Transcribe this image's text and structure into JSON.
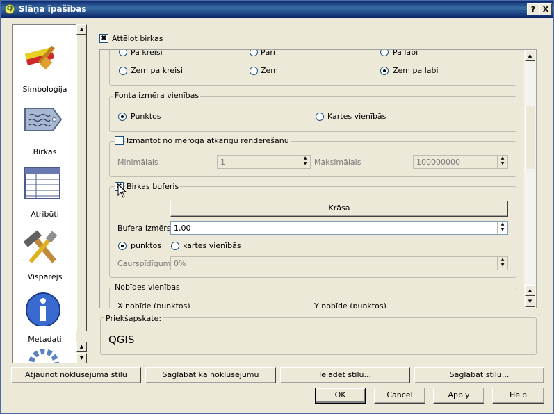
{
  "window": {
    "title": "Slāņa īpašības"
  },
  "titlebar_buttons": {
    "help": "?",
    "close": "X"
  },
  "sidebar": {
    "items": [
      {
        "label": "Simboloģija",
        "icon": "paintbrush-icon"
      },
      {
        "label": "Birkas",
        "icon": "label-tag-icon"
      },
      {
        "label": "Atribūti",
        "icon": "attribute-table-icon"
      },
      {
        "label": "Vispārējs",
        "icon": "tools-icon"
      },
      {
        "label": "Metadati",
        "icon": "info-icon"
      }
    ]
  },
  "labels": {
    "show_labels": "Attēlot birkas",
    "show_labels_checked": true
  },
  "placement": {
    "row1": [
      "Pa kreisi",
      "Pāri",
      "Pa labi"
    ],
    "row2": [
      "Zem pa kreisi",
      "Zem",
      "Zem pa labi"
    ],
    "selected": "Zem pa labi"
  },
  "font_units": {
    "title": "Fonta izmēra vienības",
    "options": [
      "Punktos",
      "Kartes vienībās"
    ],
    "selected": "Punktos"
  },
  "scale_render": {
    "title": "Izmantot no mēroga atkarīgu renderēšanu",
    "min_label": "Minimālais",
    "min_value": "1",
    "max_label": "Maksimālais",
    "max_value": "100000000"
  },
  "buffer": {
    "title": "Birkas buferis",
    "checked": true,
    "color_button": "Krāsa",
    "size_label": "Bufera izmērs",
    "size_value": "1,00",
    "units": [
      "punktos",
      "kartes vienībās"
    ],
    "selected_unit": "punktos",
    "transparency_label": "Caurspīdīgums",
    "transparency_value": "0%"
  },
  "offset": {
    "title": "Nobīdes vienības",
    "x_label": "X nobīde (punktos)",
    "y_label": "Y nobīde (punktos)"
  },
  "preview": {
    "title": "Priekšapskate:",
    "text": "QGIS"
  },
  "style_buttons": [
    "Atjaunot noklusējuma stilu",
    "Saglabāt kā noklusējumu",
    "Ielādēt stilu...",
    "Saglabāt stilu..."
  ],
  "dialog_buttons": {
    "ok": "OK",
    "cancel": "Cancel",
    "apply": "Apply",
    "help": "Help"
  },
  "scroll_arrows": {
    "up": "▲",
    "down": "▼"
  }
}
